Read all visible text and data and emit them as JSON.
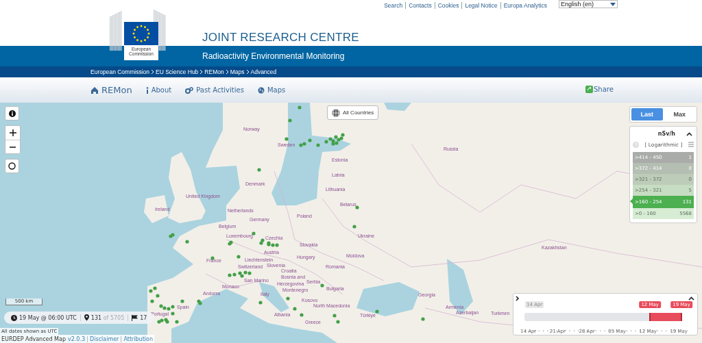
{
  "header": {
    "top_links": [
      "Search",
      "Contacts",
      "Cookies",
      "Legal Notice",
      "Europa Analytics"
    ],
    "language": "English (en)",
    "logo_text": "European Commission",
    "title": "JOINT RESEARCH CENTRE",
    "subtitle": "Radioactivity Environmental Monitoring"
  },
  "breadcrumb": [
    "European Commission",
    "EU Science Hub",
    "REMon",
    "Maps",
    "Advanced"
  ],
  "nav": {
    "brand": "REMon",
    "items": [
      "About",
      "Past Activities",
      "Maps"
    ],
    "share": "Share"
  },
  "map": {
    "country_filter": "All Countries",
    "scale": "500 km",
    "labels": [
      "Norway",
      "Sweden",
      "Russia",
      "Estonia",
      "Latvia",
      "Denmark",
      "Lithuania",
      "United Kingdom",
      "Belarus",
      "Ireland",
      "Netherlands",
      "Poland",
      "Germany",
      "Belgium",
      "Luxembourg",
      "Ukraine",
      "Czechia",
      "Slovakia",
      "Kazakhstan",
      "Austria",
      "Moldova",
      "Hungary",
      "France",
      "Liechtenstein",
      "Slovenia",
      "Switzerland",
      "Romania",
      "Croatia",
      "Bosnia and",
      "San Marino",
      "Serbia",
      "Herzegovina",
      "Monaco",
      "Montenegro",
      "Bulgaria",
      "Andorra",
      "Italy",
      "Georgia",
      "Kosovo",
      "North Macedonia",
      "Spain",
      "Armenia",
      "Portugal",
      "Azerbaijan",
      "Turkmen",
      "Albania",
      "Türkiye",
      "Greece"
    ]
  },
  "period_toggle": [
    {
      "label": "Last",
      "selected": true
    },
    {
      "label": "Max",
      "selected": false
    }
  ],
  "legend": {
    "unit": "nSv/h",
    "scale": "[ Logarithmic ]",
    "classes": [
      {
        "range": ">414 - 450",
        "count": "1",
        "color": "#a9aca8",
        "selected": false
      },
      {
        "range": ">372 - 414",
        "count": "0",
        "color": "#b4beb2",
        "selected": false
      },
      {
        "range": ">321 - 372",
        "count": "0",
        "color": "#bdccb9",
        "selected": false
      },
      {
        "range": ">254 - 321",
        "count": "5",
        "color": "#c7ddc3",
        "selected": false
      },
      {
        "range": ">160 - 254",
        "count": "131",
        "color": "#4caf50",
        "selected": true
      },
      {
        "range": ">0 - 160",
        "count": "5568",
        "color": "#d6ecd3",
        "selected": false
      }
    ]
  },
  "timeline": {
    "start_label": "14 Apr",
    "range_start": {
      "label": "12 May",
      "level": 0.8
    },
    "range_end": {
      "label": "19 May",
      "level": 1
    },
    "ticks": [
      "14 Apr",
      "21 Apr",
      "28 Apr",
      "05 May",
      "12 May",
      "19 May"
    ]
  },
  "status": {
    "time": "19 May @ 06:00 UTC",
    "stations": "131",
    "stations_total": "of 5705",
    "flags": "17"
  },
  "note": "All dates shown as UTC",
  "footer": {
    "app": "EURDEP Advanced Map",
    "version": "v2.0.3",
    "links": [
      "Disclaimer",
      "Attribution"
    ]
  }
}
